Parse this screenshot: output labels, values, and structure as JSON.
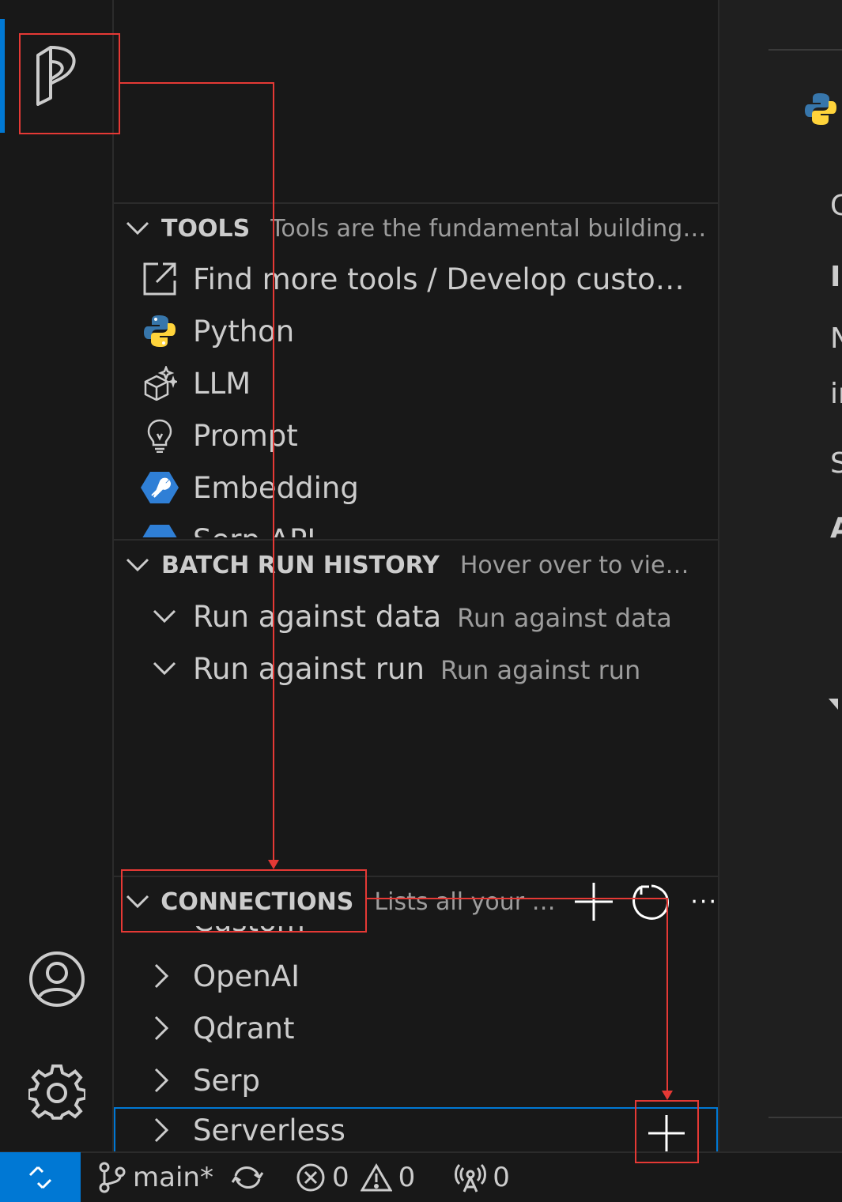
{
  "tools": {
    "title": "TOOLS",
    "description": "Tools are the fundamental building …",
    "items": [
      {
        "label": "Find more tools / Develop custom…",
        "icon": "external-link-icon"
      },
      {
        "label": "Python",
        "icon": "python-icon"
      },
      {
        "label": "LLM",
        "icon": "llm-cube-icon"
      },
      {
        "label": "Prompt",
        "icon": "lightbulb-icon"
      },
      {
        "label": "Embedding",
        "icon": "azure-tool-icon"
      },
      {
        "label": "Serp API",
        "icon": "azure-tool-icon"
      }
    ]
  },
  "batch_run_history": {
    "title": "BATCH RUN HISTORY",
    "description": "Hover over to view …",
    "items": [
      {
        "label": "Run against data",
        "description": "Run against data"
      },
      {
        "label": "Run against run",
        "description": "Run against run"
      }
    ]
  },
  "connections": {
    "title": "CONNECTIONS",
    "description": "Lists all your …",
    "partial_item": "Custom",
    "items": [
      {
        "label": "OpenAI"
      },
      {
        "label": "Qdrant"
      },
      {
        "label": "Serp"
      },
      {
        "label": "Serverless"
      }
    ]
  },
  "statusbar": {
    "branch": "main*",
    "errors": "0",
    "warnings": "0",
    "ports": "0"
  },
  "editor_fragments": [
    "C",
    "Ir",
    "N",
    "ir",
    "S",
    "A"
  ],
  "colors": {
    "accent": "#0078d4",
    "annotation": "#e53935",
    "background": "#181818"
  }
}
